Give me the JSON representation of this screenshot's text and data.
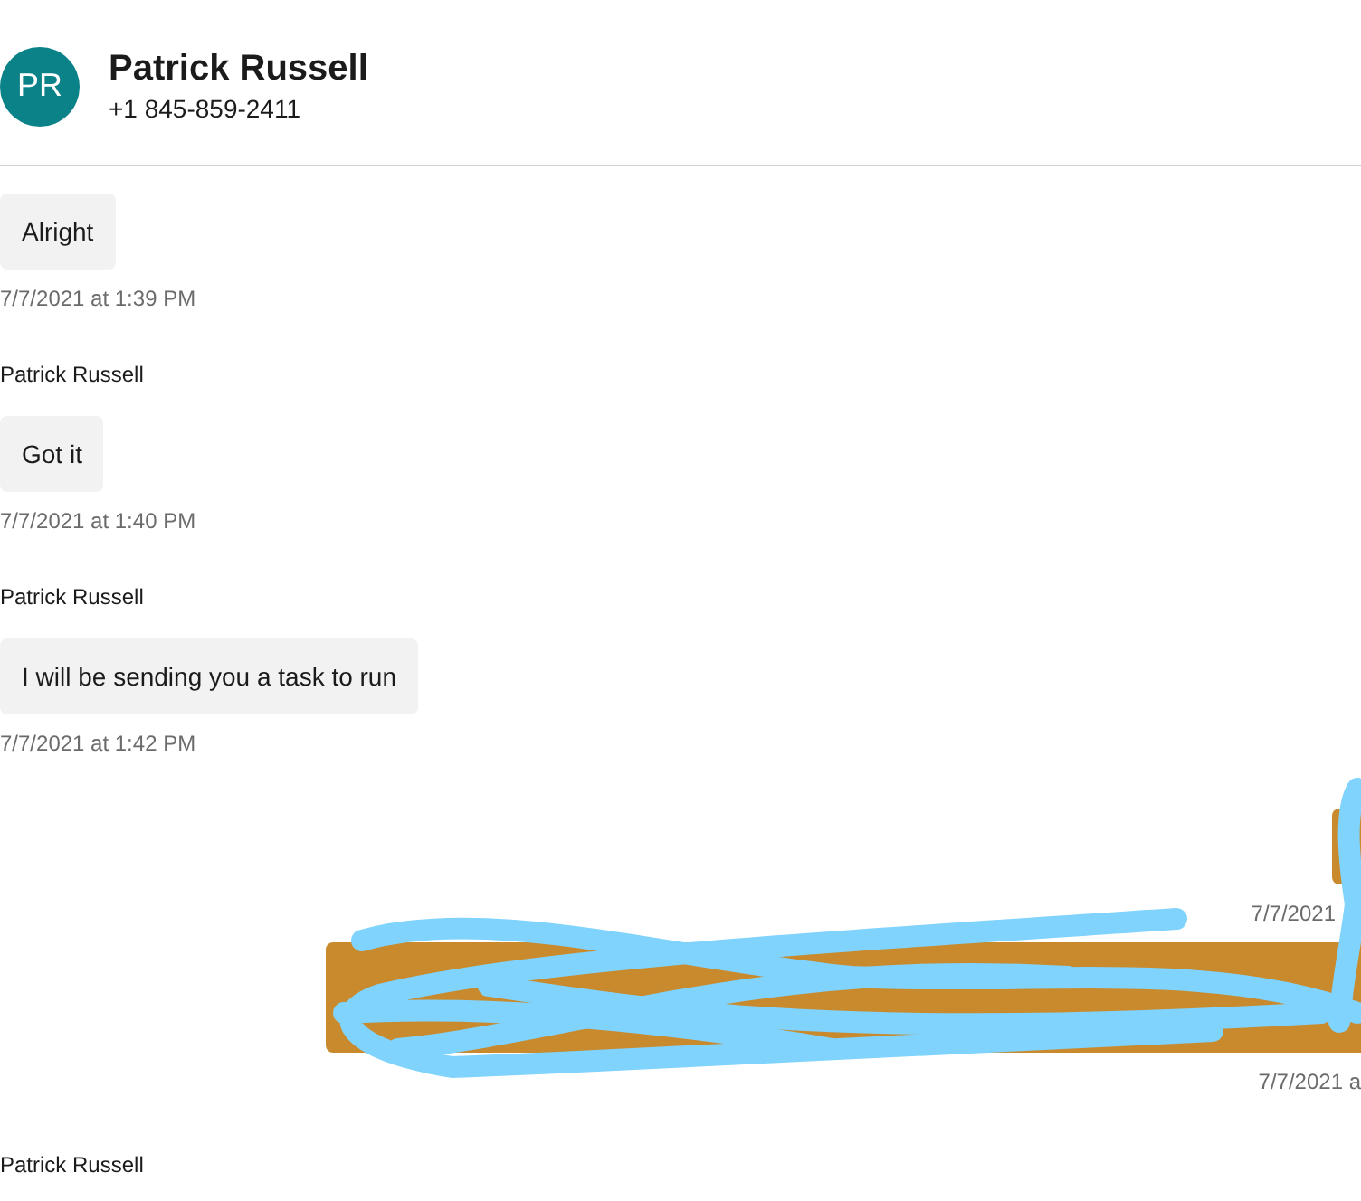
{
  "header": {
    "initials": "PR",
    "name": "Patrick Russell",
    "phone": "+1 845-859-2411"
  },
  "messages": [
    {
      "kind": "incoming",
      "text": "Alright",
      "time": "7/7/2021 at 1:39 PM"
    },
    {
      "kind": "incoming",
      "sender": "Patrick Russell",
      "text": "Got it",
      "time": "7/7/2021 at 1:40 PM"
    },
    {
      "kind": "incoming",
      "sender": "Patrick Russell",
      "text": "I will be sending you a task to run",
      "time": "7/7/2021 at 1:42 PM"
    },
    {
      "kind": "stub",
      "time": "7/7/2021"
    },
    {
      "kind": "sent",
      "time": "7/7/2021 a"
    },
    {
      "kind": "sender",
      "sender": "Patrick Russell"
    }
  ]
}
